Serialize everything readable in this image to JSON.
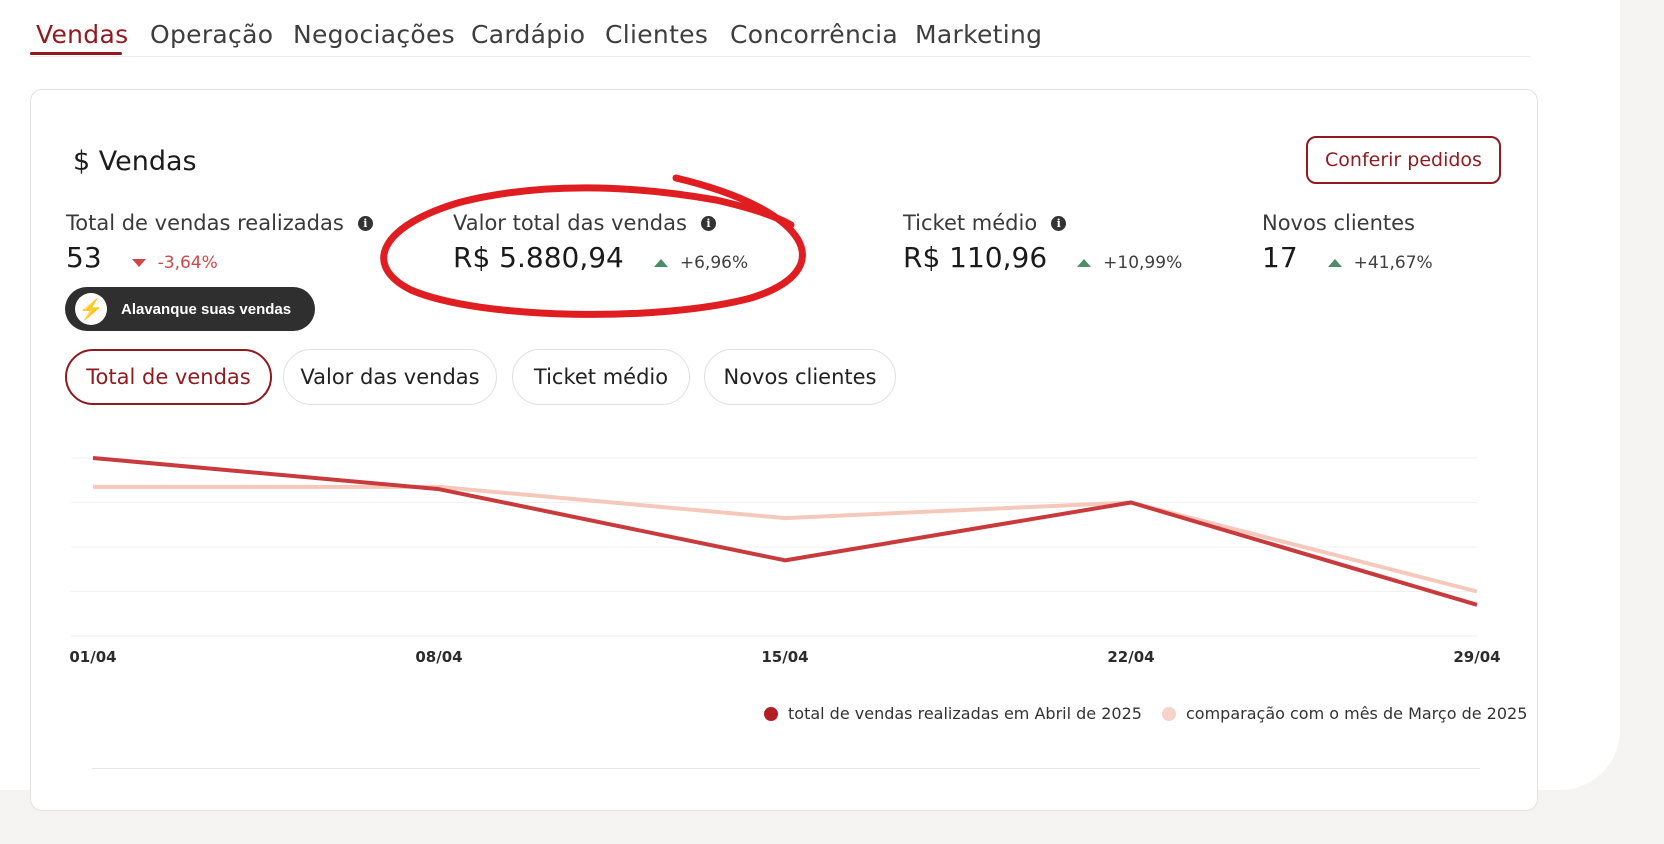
{
  "tabs": [
    "Vendas",
    "Operação",
    "Negociações",
    "Cardápio",
    "Clientes",
    "Concorrência",
    "Marketing"
  ],
  "card": {
    "title": "$ Vendas",
    "orders_button": "Conferir pedidos",
    "boost_button": "Alavanque suas vendas"
  },
  "metrics": [
    {
      "label": "Total de vendas realizadas",
      "value": "53",
      "change": "-3,64%",
      "direction": "down"
    },
    {
      "label": "Valor total das vendas",
      "value": "R$ 5.880,94",
      "change": "+6,96%",
      "direction": "up"
    },
    {
      "label": "Ticket médio",
      "value": "R$ 110,96",
      "change": "+10,99%",
      "direction": "up"
    },
    {
      "label": "Novos clientes",
      "value": "17",
      "change": "+41,67%",
      "direction": "up"
    }
  ],
  "chips": [
    "Total de vendas",
    "Valor das vendas",
    "Ticket médio",
    "Novos clientes"
  ],
  "colors": {
    "accent": "#8f1a1f",
    "current_series": "#c93a3d",
    "comparison_series": "#f6c8bc",
    "highlight_circle": "#e01e22",
    "up": "#4c8c6a",
    "down": "#d0474a"
  },
  "chart_data": {
    "type": "line",
    "x": [
      "01/04",
      "08/04",
      "15/04",
      "22/04",
      "29/04"
    ],
    "ylim": [
      0,
      4
    ],
    "grid": true,
    "legend_position": "bottom-right",
    "series": [
      {
        "name": "total de vendas realizadas em Abril de 2025",
        "values": [
          4.0,
          3.3,
          1.7,
          3.0,
          0.7
        ]
      },
      {
        "name": "comparação com o mês de Março de 2025",
        "values": [
          3.35,
          3.35,
          2.65,
          3.0,
          1.0
        ]
      }
    ]
  }
}
